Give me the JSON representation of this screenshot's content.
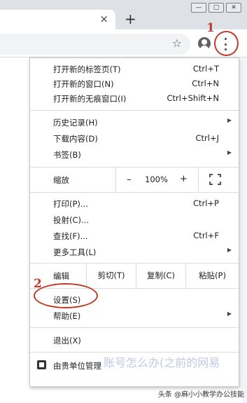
{
  "window": {
    "controls": [
      "minimize-icon",
      "restore-icon",
      "close-icon"
    ]
  },
  "tab": {
    "close_glyph": "×",
    "new_tab_glyph": "+"
  },
  "toolbar": {
    "icons": [
      "star-icon",
      "profile-icon",
      "more-icon"
    ]
  },
  "annotations": {
    "step1": "1",
    "step2": "2"
  },
  "menu": {
    "section1": [
      {
        "label": "打开新的标签页(T)",
        "shortcut": "Ctrl+T"
      },
      {
        "label": "打开新的窗口(N)",
        "shortcut": "Ctrl+N"
      },
      {
        "label": "打开新的无痕窗口(I)",
        "shortcut": "Ctrl+Shift+N"
      }
    ],
    "section2": [
      {
        "label": "历史记录(H)",
        "shortcut": "",
        "submenu": true
      },
      {
        "label": "下载内容(D)",
        "shortcut": "Ctrl+J",
        "submenu": false
      },
      {
        "label": "书签(B)",
        "shortcut": "",
        "submenu": true
      }
    ],
    "zoom": {
      "label": "缩放",
      "minus": "–",
      "value": "100%",
      "plus": "+"
    },
    "section3": [
      {
        "label": "打印(P)...",
        "shortcut": "Ctrl+P"
      },
      {
        "label": "投射(C)...",
        "shortcut": ""
      },
      {
        "label": "查找(F)...",
        "shortcut": "Ctrl+F"
      },
      {
        "label": "更多工具(L)",
        "shortcut": "",
        "submenu": true
      }
    ],
    "edit": {
      "label": "编辑",
      "cut": "剪切(T)",
      "copy": "复制(C)",
      "paste": "粘贴(P)"
    },
    "section4": [
      {
        "label": "设置(S)",
        "highlighted": true
      },
      {
        "label": "帮助(E)",
        "submenu": true
      }
    ],
    "exit": {
      "label": "退出(X)"
    },
    "managed": {
      "label": "由贵单位管理"
    }
  },
  "overlay": {
    "text": "账号怎么办(之前的网易"
  },
  "credit": "头条 @麻小小教学办公技能",
  "colors": {
    "annotation": "#c0392b",
    "menu_border": "#c8cbcf"
  }
}
